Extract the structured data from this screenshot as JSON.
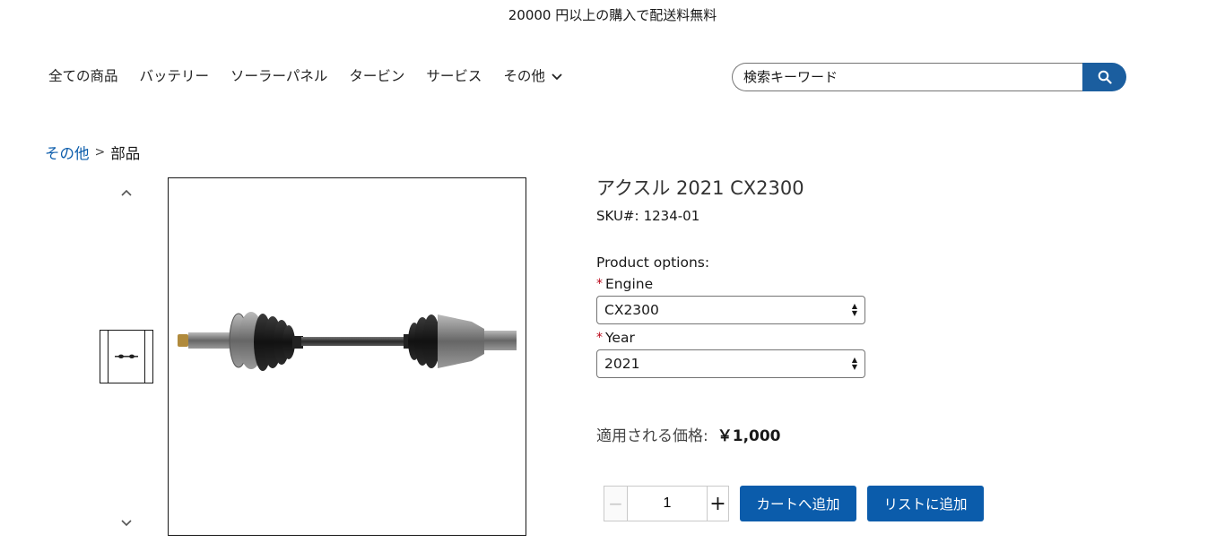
{
  "promo": {
    "text": "20000 円以上の購入で配送料無料"
  },
  "nav": {
    "items": [
      {
        "label": "全ての商品"
      },
      {
        "label": "バッテリー"
      },
      {
        "label": "ソーラーパネル"
      },
      {
        "label": "タービン"
      },
      {
        "label": "サービス"
      },
      {
        "label": "その他"
      }
    ]
  },
  "search": {
    "placeholder": "検索キーワード",
    "icon": "search-icon"
  },
  "breadcrumb": {
    "parent": "その他",
    "separator": ">",
    "current": "部品"
  },
  "gallery": {
    "up_icon": "chevron-up-icon",
    "down_icon": "chevron-down-icon",
    "main_image": "axle-product-image"
  },
  "product": {
    "title_name": "アクスル",
    "title_detail": "2021 CX2300",
    "sku_label": "SKU#:",
    "sku_value": "1234-01",
    "options_label": "Product options:",
    "engine_label": "Engine",
    "engine_value": "CX2300",
    "year_label": "Year",
    "year_value": "2021",
    "required_mark": "*"
  },
  "price": {
    "label": "適用される価格:",
    "value": "￥1,000"
  },
  "quantity": {
    "minus": "−",
    "value": "1",
    "plus": "+"
  },
  "actions": {
    "add_to_cart": "カートへ追加",
    "add_to_list": "リストに追加"
  },
  "colors": {
    "brand_blue": "#0b5cab",
    "search_blue": "#1b5e9f",
    "required_red": "#ba0517"
  }
}
